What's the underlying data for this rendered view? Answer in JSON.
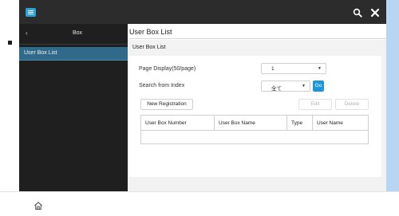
{
  "header": {
    "menu_icon": "hamburger-menu-icon",
    "search_icon": "search-icon",
    "close_icon": "close-icon",
    "bar_color": "#2c2c2c",
    "accent": "#2aa3d9"
  },
  "sidebar": {
    "back_icon": "chevron-left-icon",
    "back_glyph": "‹",
    "title": "Box",
    "items": [
      {
        "label": "User Box List",
        "selected": true
      }
    ]
  },
  "main": {
    "title": "User Box List",
    "panel_title": "User Box List",
    "page_display": {
      "label": "Page Display(50/page)",
      "value": "1"
    },
    "search_index": {
      "label": "Search from Index",
      "value": "全て",
      "go_label": "Go"
    },
    "buttons": {
      "new_registration": "New Registration",
      "edit": "Edit",
      "delete": "Delete"
    },
    "table": {
      "columns": [
        "User Box Number",
        "User Box Name",
        "Type",
        "User Name"
      ],
      "rows": []
    }
  },
  "footer": {
    "home_icon": "home-icon"
  },
  "colors": {
    "sidebar_bg": "#1f1f1f",
    "sidebar_selected": "#2f6a8a",
    "go_button": "#1e97d6",
    "bezel": "#b8d6f2"
  }
}
